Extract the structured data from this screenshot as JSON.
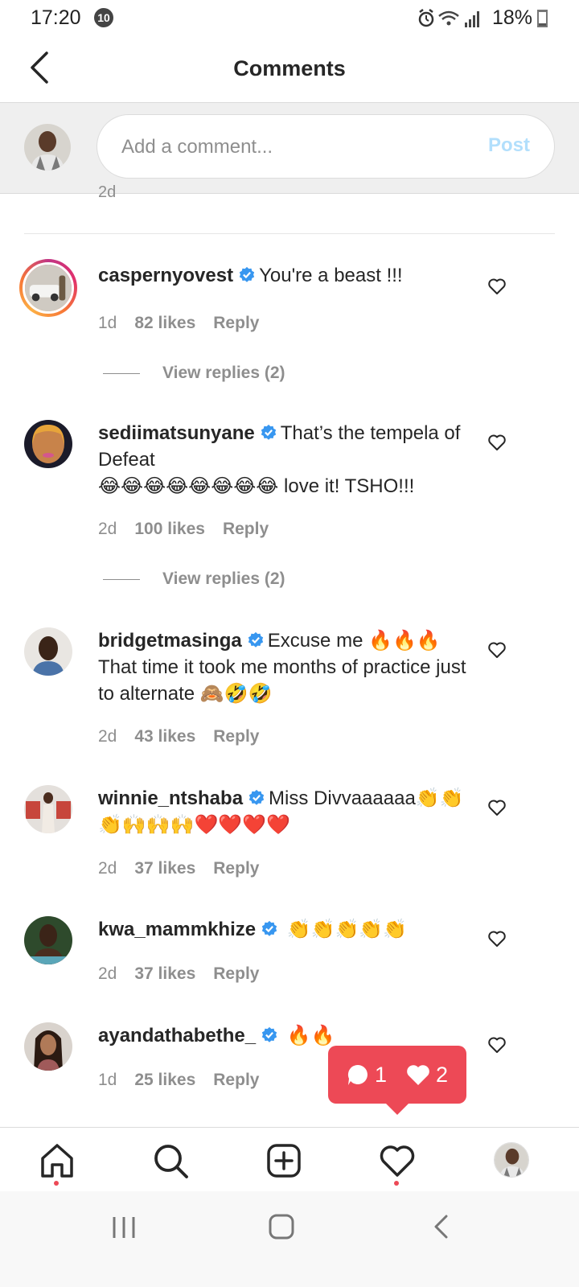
{
  "status_bar": {
    "time": "17:20",
    "notification_count": "10",
    "battery_text": "18%",
    "battery_level": 0.18
  },
  "header": {
    "title": "Comments"
  },
  "composer": {
    "placeholder": "Add a comment...",
    "post_label": "Post"
  },
  "previous_time_partial": "2d",
  "comments": [
    {
      "username": "caspernyovest",
      "text": "You're a beast !!!",
      "time": "1d",
      "likes": "82 likes",
      "reply": "Reply",
      "view_replies": "View replies (2)"
    },
    {
      "username": "sediimatsunyane",
      "text": "That’s the tempela of Defeat",
      "text2": "😂😂😂😂😂😂😂😂 love it! TSHO!!!",
      "time": "2d",
      "likes": "100 likes",
      "reply": "Reply",
      "view_replies": "View replies (2)"
    },
    {
      "username": "bridgetmasinga",
      "text": "Excuse me 🔥🔥🔥 That time it took me months of practice just to alternate 🙈🤣🤣",
      "time": "2d",
      "likes": "43 likes",
      "reply": "Reply"
    },
    {
      "username": "winnie_ntshaba",
      "text": "Miss Divvaaaaaa👏👏👏🙌🙌🙌❤️❤️❤️❤️",
      "time": "2d",
      "likes": "37 likes",
      "reply": "Reply"
    },
    {
      "username": "kwa_mammkhize",
      "text": "👏👏👏👏👏",
      "time": "2d",
      "likes": "37 likes",
      "reply": "Reply"
    },
    {
      "username": "ayandathabethe_",
      "text": "🔥🔥",
      "time": "1d",
      "likes": "25 likes",
      "reply": "Reply"
    }
  ],
  "activity_popup": {
    "comments_count": "1",
    "likes_count": "2"
  },
  "colors": {
    "accent_red": "#ed4956",
    "verified_blue": "#3897f0",
    "post_disabled": "#b2dffc",
    "meta_gray": "#8e8e8e"
  }
}
